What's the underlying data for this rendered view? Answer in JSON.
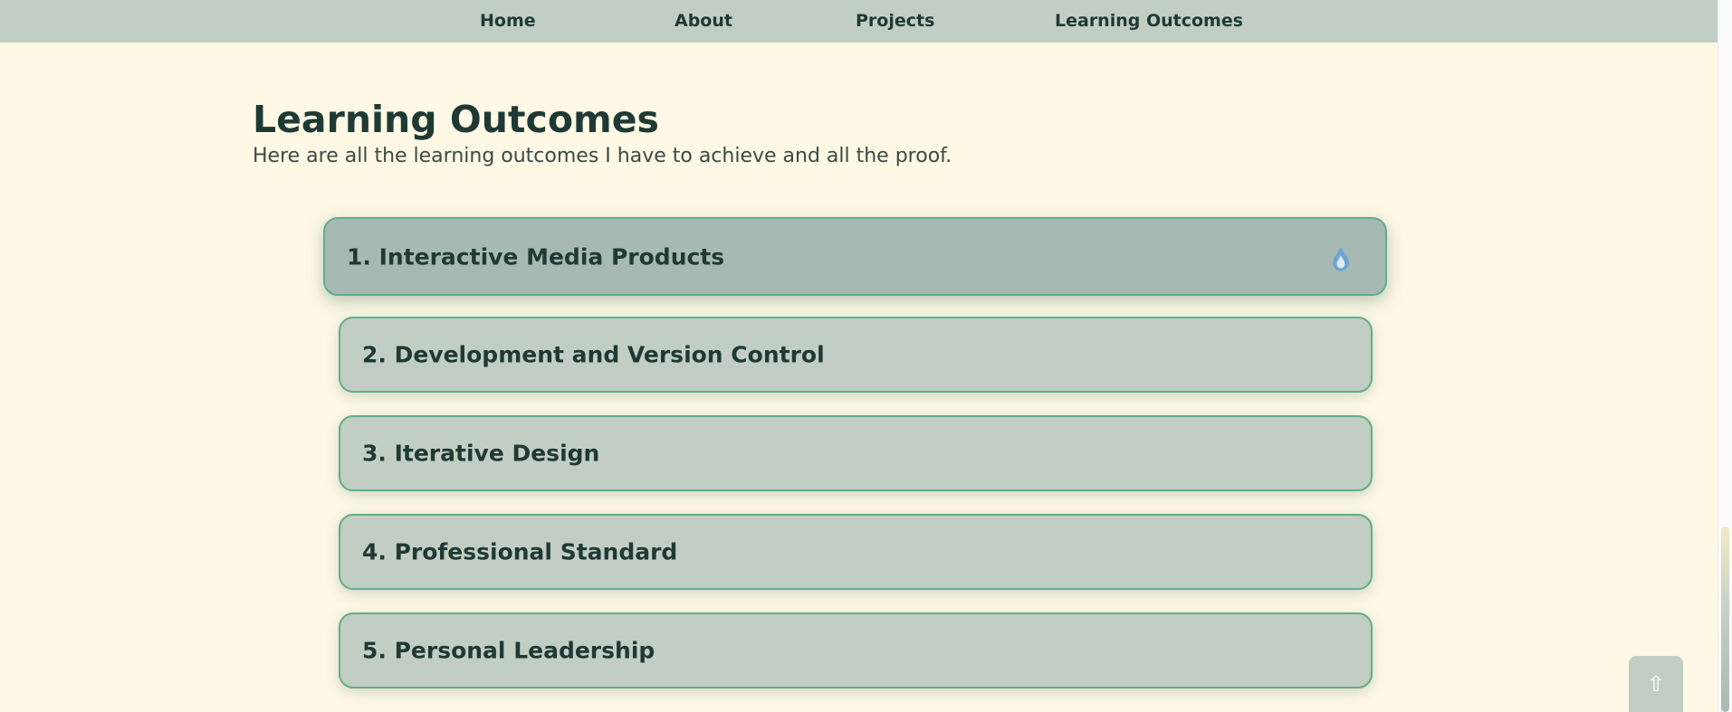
{
  "nav": {
    "home": "Home",
    "about": "About",
    "projects": "Projects",
    "learning_outcomes": "Learning Outcomes"
  },
  "header": {
    "title": "Learning Outcomes",
    "subtitle": "Here are all the learning outcomes I have to achieve and all the proof."
  },
  "outcomes": [
    {
      "label": "1. Interactive Media Products",
      "active": true,
      "icon": "water-drop-icon"
    },
    {
      "label": "2. Development and Version Control"
    },
    {
      "label": "3. Iterative Design"
    },
    {
      "label": "4. Professional Standard"
    },
    {
      "label": "5. Personal Leadership"
    }
  ],
  "back_to_top": {
    "symbol": "⇧"
  },
  "colors": {
    "background": "#fef8e5",
    "nav_bar": "#c2cec4",
    "card": "#c2cec4",
    "card_active": "#a6bab3",
    "card_border": "#5faf8c",
    "text": "#1f3a34"
  }
}
